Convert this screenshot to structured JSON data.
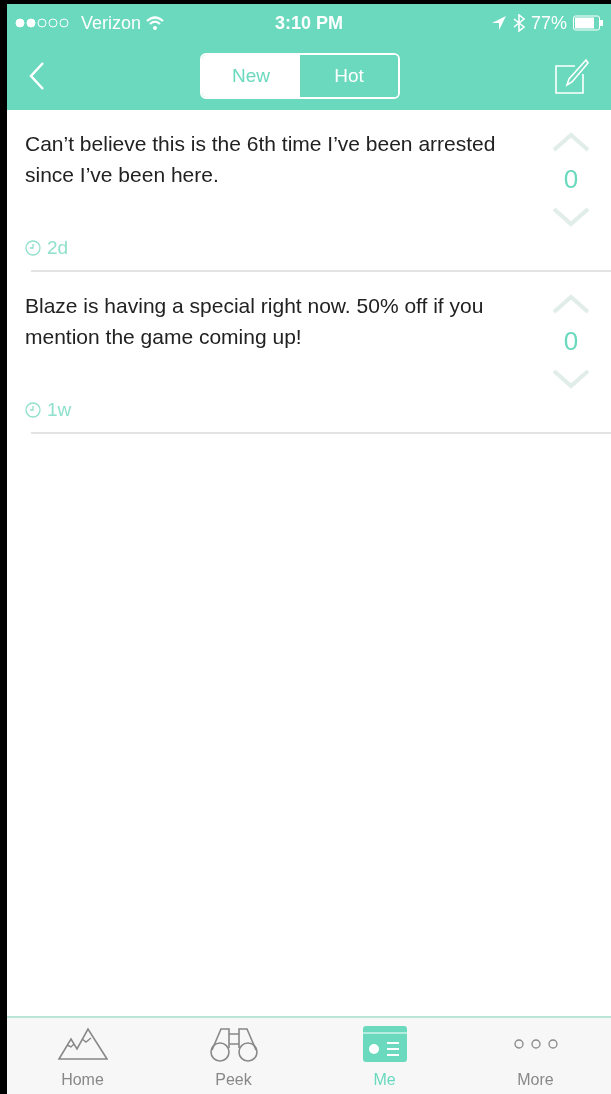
{
  "status_bar": {
    "carrier": "Verizon",
    "time": "3:10 PM",
    "battery": "77%"
  },
  "nav": {
    "segments": [
      {
        "label": "New",
        "selected": true
      },
      {
        "label": "Hot",
        "selected": false
      }
    ]
  },
  "posts": [
    {
      "text": "Can’t believe this is the 6th time I’ve been arrested since I’ve been here.",
      "votes": "0",
      "age": "2d"
    },
    {
      "text": "Blaze is having a special right now. 50% off if you mention the game coming up!",
      "votes": "0",
      "age": "1w"
    }
  ],
  "tab_bar": [
    {
      "kind": "home",
      "label": "Home",
      "selected": false
    },
    {
      "kind": "peek",
      "label": "Peek",
      "selected": false
    },
    {
      "kind": "me",
      "label": "Me",
      "selected": true
    },
    {
      "kind": "more",
      "label": "More",
      "selected": false
    }
  ]
}
